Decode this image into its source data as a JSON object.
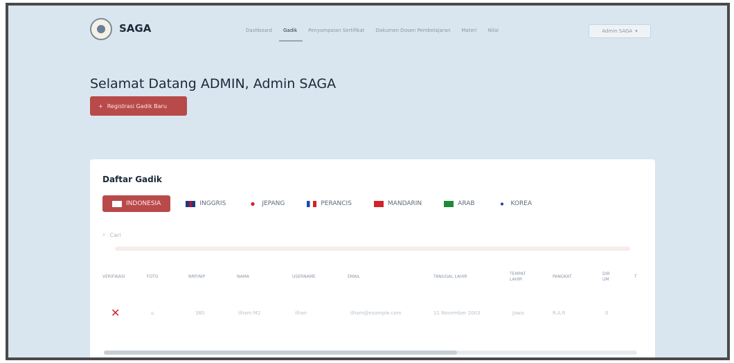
{
  "app": {
    "brand": "SAGA",
    "user_menu": "Admin SAGA",
    "caret": "▾"
  },
  "nav": [
    {
      "label": "Dashboard"
    },
    {
      "label": "Gadik"
    },
    {
      "label": "Penyampaian Sertifikat"
    },
    {
      "label": "Dokumen Dosen Pembelajaran"
    },
    {
      "label": "Materi"
    },
    {
      "label": "Nilai"
    }
  ],
  "welcome": "Selamat Datang ADMIN, Admin SAGA",
  "register_button": {
    "icon": "+",
    "label": "Registrasi Gadik Baru"
  },
  "card": {
    "title": "Daftar Gadik"
  },
  "tabs": [
    {
      "label": "INDONESIA",
      "flag": "indonesia-flag"
    },
    {
      "label": "INGGRIS",
      "flag": "uk-flag"
    },
    {
      "label": "JEPANG",
      "flag": "japan-flag"
    },
    {
      "label": "PERANCIS",
      "flag": "france-flag"
    },
    {
      "label": "MANDARIN",
      "flag": "china-flag"
    },
    {
      "label": "ARAB",
      "flag": "saudi-flag"
    },
    {
      "label": "KOREA",
      "flag": "korea-flag"
    }
  ],
  "search": {
    "placeholder": "Cari"
  },
  "table": {
    "columns": [
      "VERIFIKASI",
      "FOTO",
      "NRP/NIP",
      "NAMA",
      "USERNAME",
      "EMAIL",
      "TANGGAL LAHIR",
      "TEMPAT LAHIR",
      "PANGKAT",
      "DIR UM",
      "T"
    ],
    "rows": [
      {
        "verified": "✕",
        "photo": "⌂",
        "nrp": "380",
        "nama": "ilham M2",
        "username": "ilhan",
        "email": "ilham@example.com",
        "tanggal": "11 November 2003",
        "tempat": "Jawa",
        "pangkat": "R.A.R",
        "dir": "0"
      }
    ]
  },
  "colors": {
    "accent": "#b84a4a",
    "background": "#d9e6ef",
    "error": "#d2232a"
  }
}
